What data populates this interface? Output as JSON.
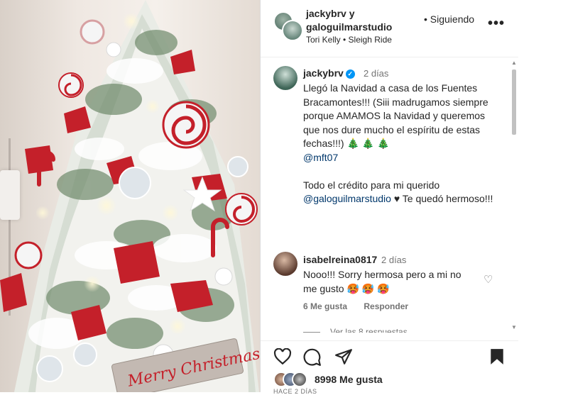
{
  "header": {
    "users_line1": "jackybrv y",
    "users_line2": "galoguilmarstudio",
    "music": "Tori Kelly • Sleigh Ride",
    "follow_label": "• Siguiendo",
    "more": "•••"
  },
  "caption": {
    "username": "jackybrv",
    "time": "2 días",
    "text_1": "Llegó la Navidad a casa de los Fuentes Bracamontes!!! (Siii madrugamos siempre porque AMAMOS la Navidad y queremos que nos dure mucho el espíritu de estas fechas!!!) 🎄 🎄 🎄",
    "mention_1": "@mft07",
    "text_2": "Todo el crédito para mi querido",
    "mention_2": "@galoguilmarstudio",
    "text_3": " ♥ Te quedó hermoso!!!"
  },
  "comment": {
    "username": "isabelreina0817",
    "time": "2 días",
    "text": "Nooo!!! Sorry hermosa pero a mi no me gusto 🥵 🥵 🥵",
    "likes": "6 Me gusta",
    "reply": "Responder",
    "view_replies": "Ver las 8 respuestas"
  },
  "footer": {
    "likes": "8998 Me gusta",
    "date": "HACE 2 DÍAS"
  },
  "photo": {
    "sign_text": "Merry Christmas"
  }
}
